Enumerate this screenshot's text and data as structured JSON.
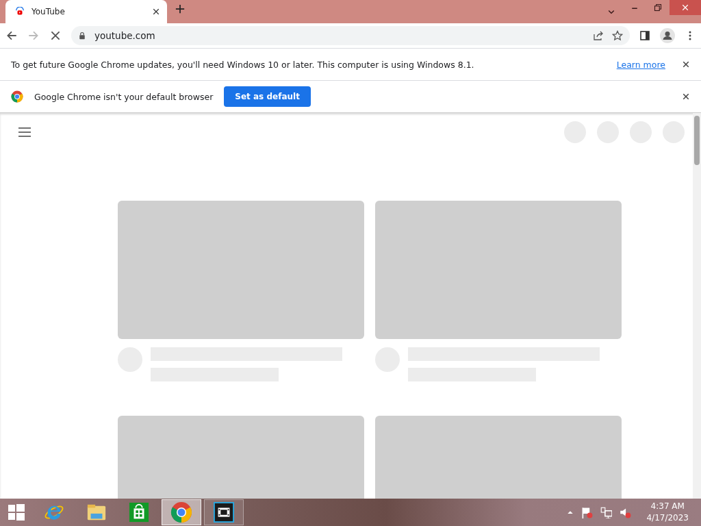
{
  "browser": {
    "tabs": [
      {
        "title": "YouTube",
        "selected": true
      }
    ],
    "address": "youtube.com",
    "loading": true
  },
  "infobars": [
    {
      "kind": "notice",
      "text": "To get future Google Chrome updates, you'll need Windows 10 or later. This computer is using Windows 8.1.",
      "link": "Learn more"
    },
    {
      "kind": "default",
      "text": "Google Chrome isn't your default browser",
      "button": "Set as default"
    }
  ],
  "taskbar": {
    "apps": [
      {
        "kind": "ie",
        "selected": false,
        "running": false
      },
      {
        "kind": "explorer",
        "selected": false,
        "running": false
      },
      {
        "kind": "store",
        "selected": false,
        "running": false
      },
      {
        "kind": "chrome",
        "selected": true,
        "running": true
      },
      {
        "kind": "video",
        "selected": false,
        "running": true
      }
    ],
    "time": "4:37 AM",
    "date": "4/17/2023"
  }
}
